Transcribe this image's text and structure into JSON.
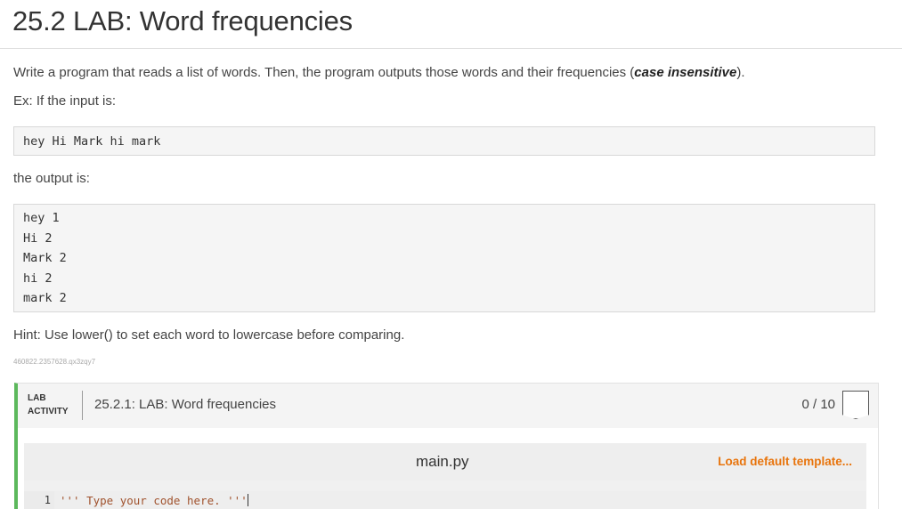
{
  "page": {
    "title": "25.2 LAB: Word frequencies",
    "description_prefix": "Write a program that reads a list of words. Then, the program outputs those words and their frequencies (",
    "description_bold": "case insensitive",
    "description_suffix": ").",
    "example_intro": "Ex: If the input is:",
    "input_example": "hey Hi Mark hi mark",
    "output_intro": "the output is:",
    "output_lines": [
      "hey 1",
      "Hi 2",
      "Mark 2",
      "hi 2",
      "mark 2"
    ],
    "hint": "Hint: Use lower() to set each word to lowercase before comparing.",
    "tag_id": "460822.2357628.qx3zqy7"
  },
  "lab": {
    "label_line1": "LAB",
    "label_line2": "ACTIVITY",
    "title": "25.2.1: LAB: Word frequencies",
    "score": "0 / 10",
    "accent_color": "#5cb85c"
  },
  "editor": {
    "file_name": "main.py",
    "load_template": "Load default template...",
    "lines": [
      {
        "number": "1",
        "code": "''' Type your code here. '''"
      }
    ]
  }
}
